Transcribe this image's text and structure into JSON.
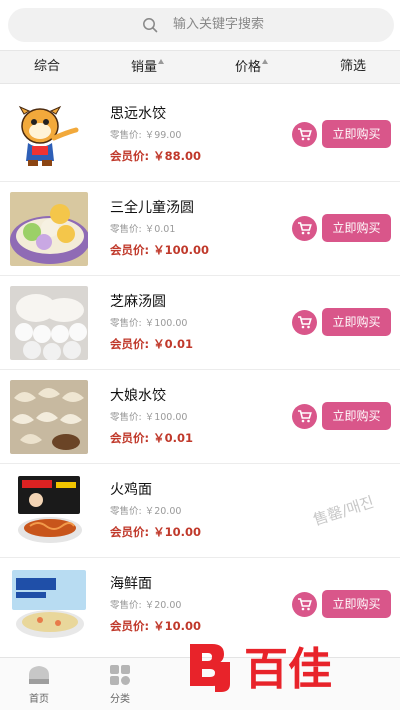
{
  "search": {
    "placeholder": "输入关键字搜索"
  },
  "filters": [
    {
      "label": "综合",
      "sortable": false
    },
    {
      "label": "销量",
      "sortable": true
    },
    {
      "label": "价格",
      "sortable": true
    },
    {
      "label": "筛选",
      "sortable": false
    }
  ],
  "products": [
    {
      "name": "思远水饺",
      "retail": "零售价: ￥99.00",
      "member": "会员价: ￥88.00",
      "buy_label": "立即购买",
      "image": "tiger-mascot"
    },
    {
      "name": "三全儿童汤圆",
      "retail": "零售价: ￥0.01",
      "member": "会员价: ￥100.00",
      "buy_label": "立即购买",
      "image": "colored-tangyuan"
    },
    {
      "name": "芝麻汤圆",
      "retail": "零售价: ￥100.00",
      "member": "会员价: ￥0.01",
      "buy_label": "立即购买",
      "image": "sesame-tangyuan"
    },
    {
      "name": "大娘水饺",
      "retail": "零售价: ￥100.00",
      "member": "会员价: ￥0.01",
      "buy_label": "立即购买",
      "image": "dumplings"
    },
    {
      "name": "火鸡面",
      "retail": "零售价: ￥20.00",
      "member": "会员价: ￥10.00",
      "buy_label": "",
      "image": "fire-noodle-pack"
    },
    {
      "name": "海鲜面",
      "retail": "零售价: ￥20.00",
      "member": "会员价: ￥10.00",
      "buy_label": "立即购买",
      "image": "seafood-noodle-pack"
    }
  ],
  "watermark": "售罄/매진",
  "tabs": [
    {
      "label": "首页",
      "icon": "home-icon"
    },
    {
      "label": "分类",
      "icon": "category-icon"
    }
  ],
  "brand": {
    "text": "百佳",
    "logo": "BJ",
    "color": "#e8232a"
  },
  "colors": {
    "accent": "#d9568a",
    "member_price": "#c0392b"
  }
}
